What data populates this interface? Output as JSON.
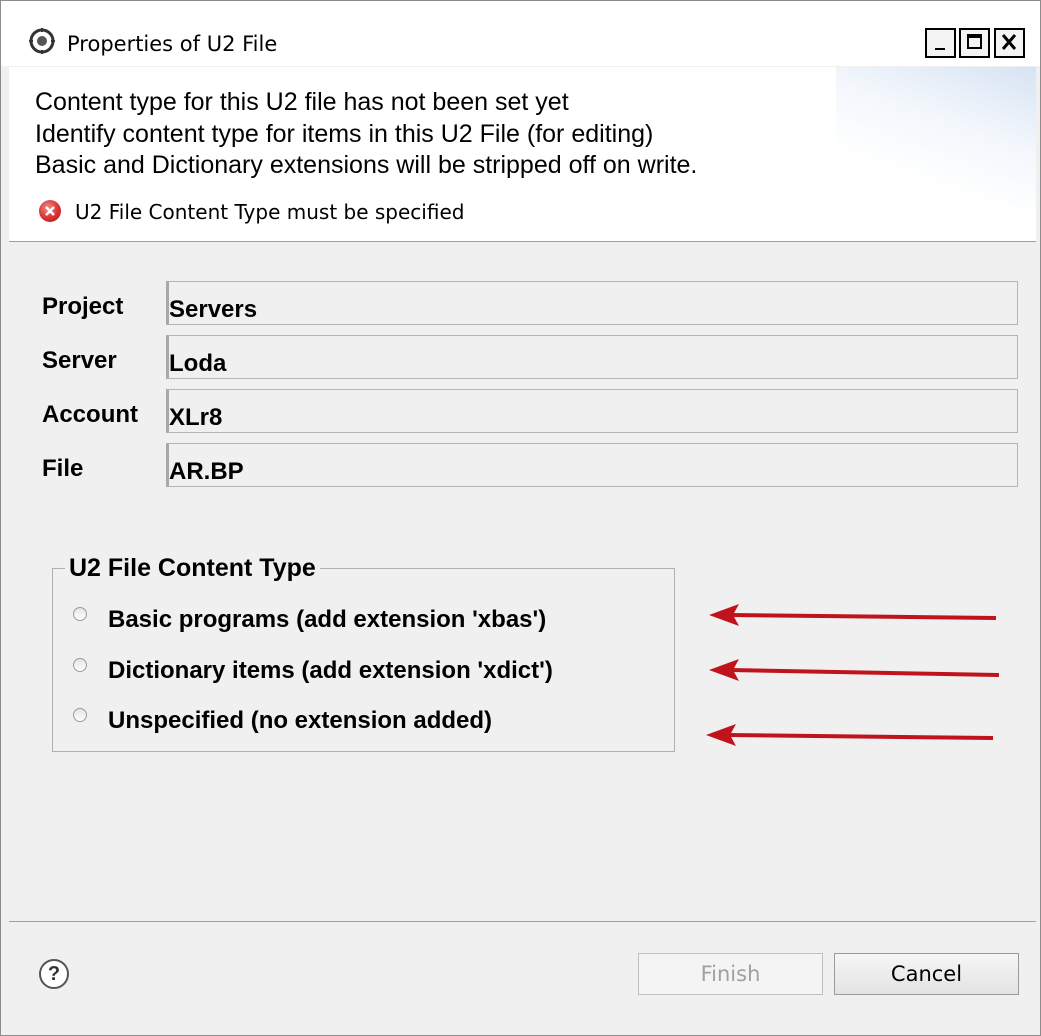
{
  "window": {
    "title": "Properties of U2 File",
    "min_glyph": "_",
    "max_glyph": "□",
    "close_glyph": "✕"
  },
  "header": {
    "lines": [
      "Content type for this U2 file has not been set yet",
      "Identify content type for items in this U2 File (for editing)",
      "Basic and Dictionary extensions will be stripped off on write."
    ],
    "error": "U2 File Content Type must be specified"
  },
  "info": [
    {
      "label": "Project",
      "value": "Servers"
    },
    {
      "label": "Server",
      "value": "Loda"
    },
    {
      "label": "Account",
      "value": "XLr8"
    },
    {
      "label": "File",
      "value": "AR.BP"
    }
  ],
  "content_type": {
    "title": "U2 File Content Type",
    "options": [
      {
        "label": "Basic programs (add extension 'xbas')",
        "selected": false
      },
      {
        "label": "Dictionary items (add extension 'xdict')",
        "selected": false
      },
      {
        "label": "Unspecified (no extension added)",
        "selected": false
      }
    ]
  },
  "footer": {
    "help": "?",
    "finish": "Finish",
    "cancel": "Cancel"
  },
  "colors": {
    "arrow": "#c0141c",
    "error": "#d93030"
  }
}
